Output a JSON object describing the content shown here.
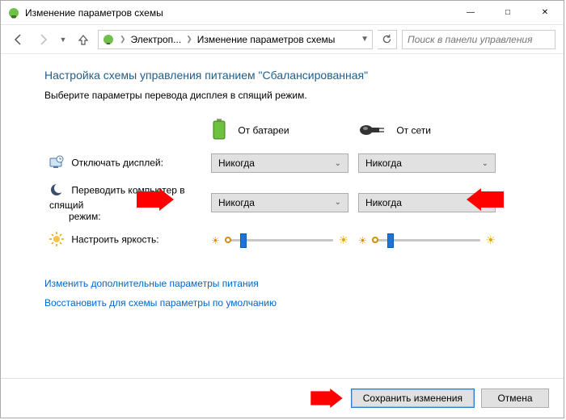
{
  "window": {
    "title": "Изменение параметров схемы"
  },
  "nav": {
    "crumb1": "Электроп...",
    "crumb2": "Изменение параметров схемы",
    "search_placeholder": "Поиск в панели управления"
  },
  "page": {
    "heading": "Настройка схемы управления питанием \"Сбалансированная\"",
    "subtext": "Выберите параметры перевода дисплея в спящий режим.",
    "col_battery": "От батареи",
    "col_ac": "От сети",
    "row_display": "Отключать дисплей:",
    "row_sleep_a": "Переводить компьютер в спящий",
    "row_sleep_b": "режим:",
    "row_brightness": "Настроить яркость:",
    "dd_display_battery": "Никогда",
    "dd_display_ac": "Никогда",
    "dd_sleep_battery": "Никогда",
    "dd_sleep_ac": "Никогда",
    "link_advanced": "Изменить дополнительные параметры питания",
    "link_restore": "Восстановить для схемы параметры по умолчанию"
  },
  "footer": {
    "save": "Сохранить изменения",
    "cancel": "Отмена"
  }
}
